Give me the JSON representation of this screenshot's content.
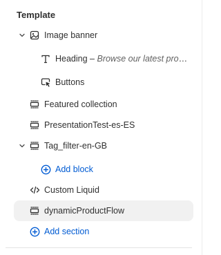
{
  "panel": {
    "title": "Template"
  },
  "tree": {
    "image_banner": {
      "label": "Image banner",
      "icon": "image-banner-icon"
    },
    "heading": {
      "label": "Heading",
      "separator": " – ",
      "subtitle": "Browse our latest products",
      "icon": "text-icon"
    },
    "buttons": {
      "label": "Buttons",
      "icon": "button-cursor-icon"
    },
    "featured_collection": {
      "label": "Featured collection",
      "icon": "section-icon"
    },
    "presentation_test": {
      "label": "PresentationTest-es-ES",
      "icon": "section-icon"
    },
    "tag_filter": {
      "label": "Tag_filter-en-GB",
      "icon": "section-icon"
    },
    "add_block": {
      "label": "Add block",
      "icon": "plus-circle-icon"
    },
    "custom_liquid": {
      "label": "Custom Liquid",
      "icon": "code-icon"
    },
    "dynamic_product_flow": {
      "label": "dynamicProductFlow",
      "icon": "section-icon",
      "selected": true
    },
    "add_section": {
      "label": "Add section",
      "icon": "plus-circle-icon"
    }
  },
  "colors": {
    "text": "#303030",
    "link": "#005bd3",
    "selected_bg": "#f1f1f1",
    "muted": "#616161"
  }
}
